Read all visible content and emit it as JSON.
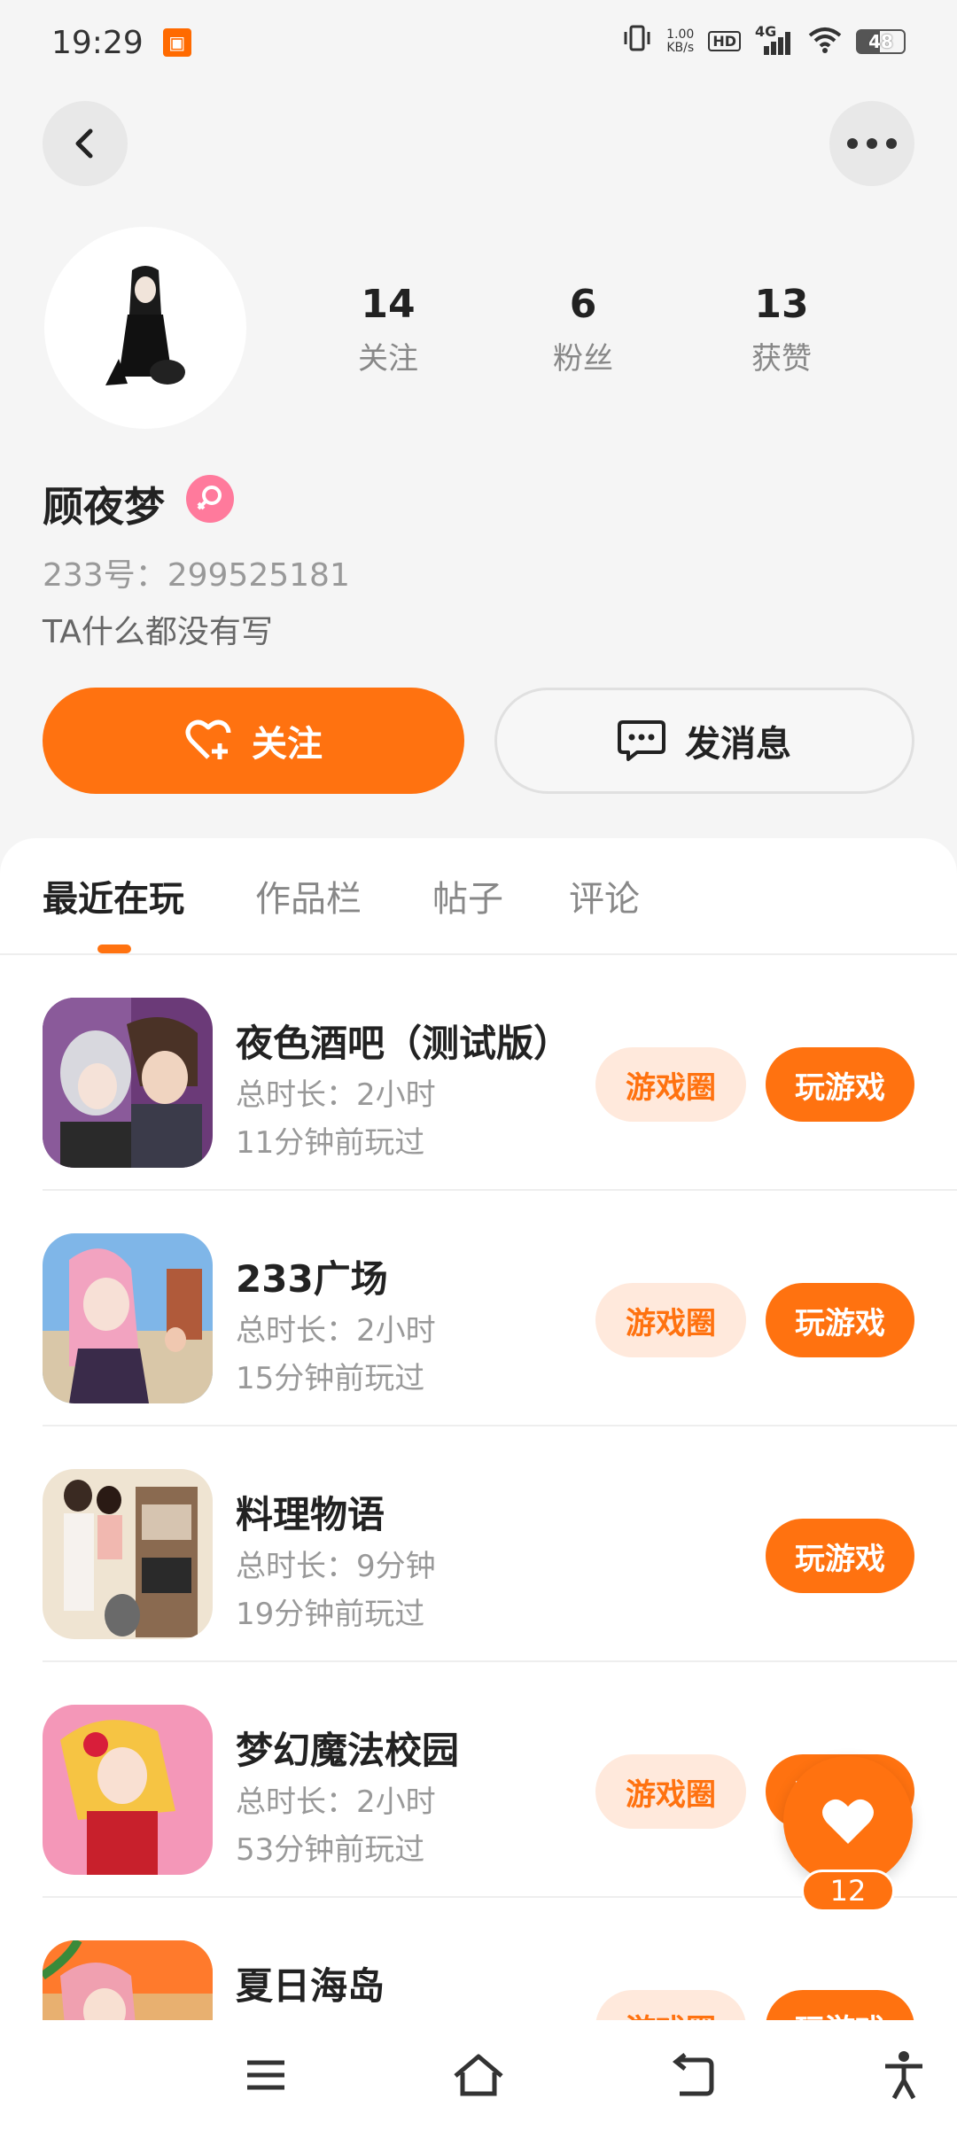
{
  "status_bar": {
    "time": "19:29",
    "speed_value": "1.00",
    "speed_unit": "KB/s",
    "hd": "HD",
    "network": "4G",
    "battery": "48"
  },
  "profile": {
    "nickname": "顾夜梦",
    "uid": "233号：299525181",
    "bio": "TA什么都没有写",
    "stats": [
      {
        "num": "14",
        "label": "关注"
      },
      {
        "num": "6",
        "label": "粉丝"
      },
      {
        "num": "13",
        "label": "获赞"
      }
    ],
    "follow_label": "关注",
    "message_label": "发消息"
  },
  "tabs": [
    {
      "label": "最近在玩",
      "active": true
    },
    {
      "label": "作品栏",
      "active": false
    },
    {
      "label": "帖子",
      "active": false
    },
    {
      "label": "评论",
      "active": false
    }
  ],
  "games": [
    {
      "name": "夜色酒吧（测试版）",
      "duration": "总时长：2小时",
      "last_played": "11分钟前玩过",
      "circle_label": "游戏圈",
      "play_label": "玩游戏"
    },
    {
      "name": "233广场",
      "duration": "总时长：2小时",
      "last_played": "15分钟前玩过",
      "circle_label": "游戏圈",
      "play_label": "玩游戏"
    },
    {
      "name": "料理物语",
      "duration": "总时长：9分钟",
      "last_played": "19分钟前玩过",
      "circle_label": "",
      "play_label": "玩游戏"
    },
    {
      "name": "梦幻魔法校园",
      "duration": "总时长：2小时",
      "last_played": "53分钟前玩过",
      "circle_label": "游戏圈",
      "play_label": "玩游戏"
    },
    {
      "name": "夏日海岛",
      "duration": "",
      "last_played": "",
      "circle_label": "游戏圈",
      "play_label": "玩游戏"
    }
  ],
  "float_like": {
    "count": "12"
  },
  "colors": {
    "accent": "#ff7210",
    "accent_light": "#ffe9dc",
    "female": "#ff7a9c"
  }
}
